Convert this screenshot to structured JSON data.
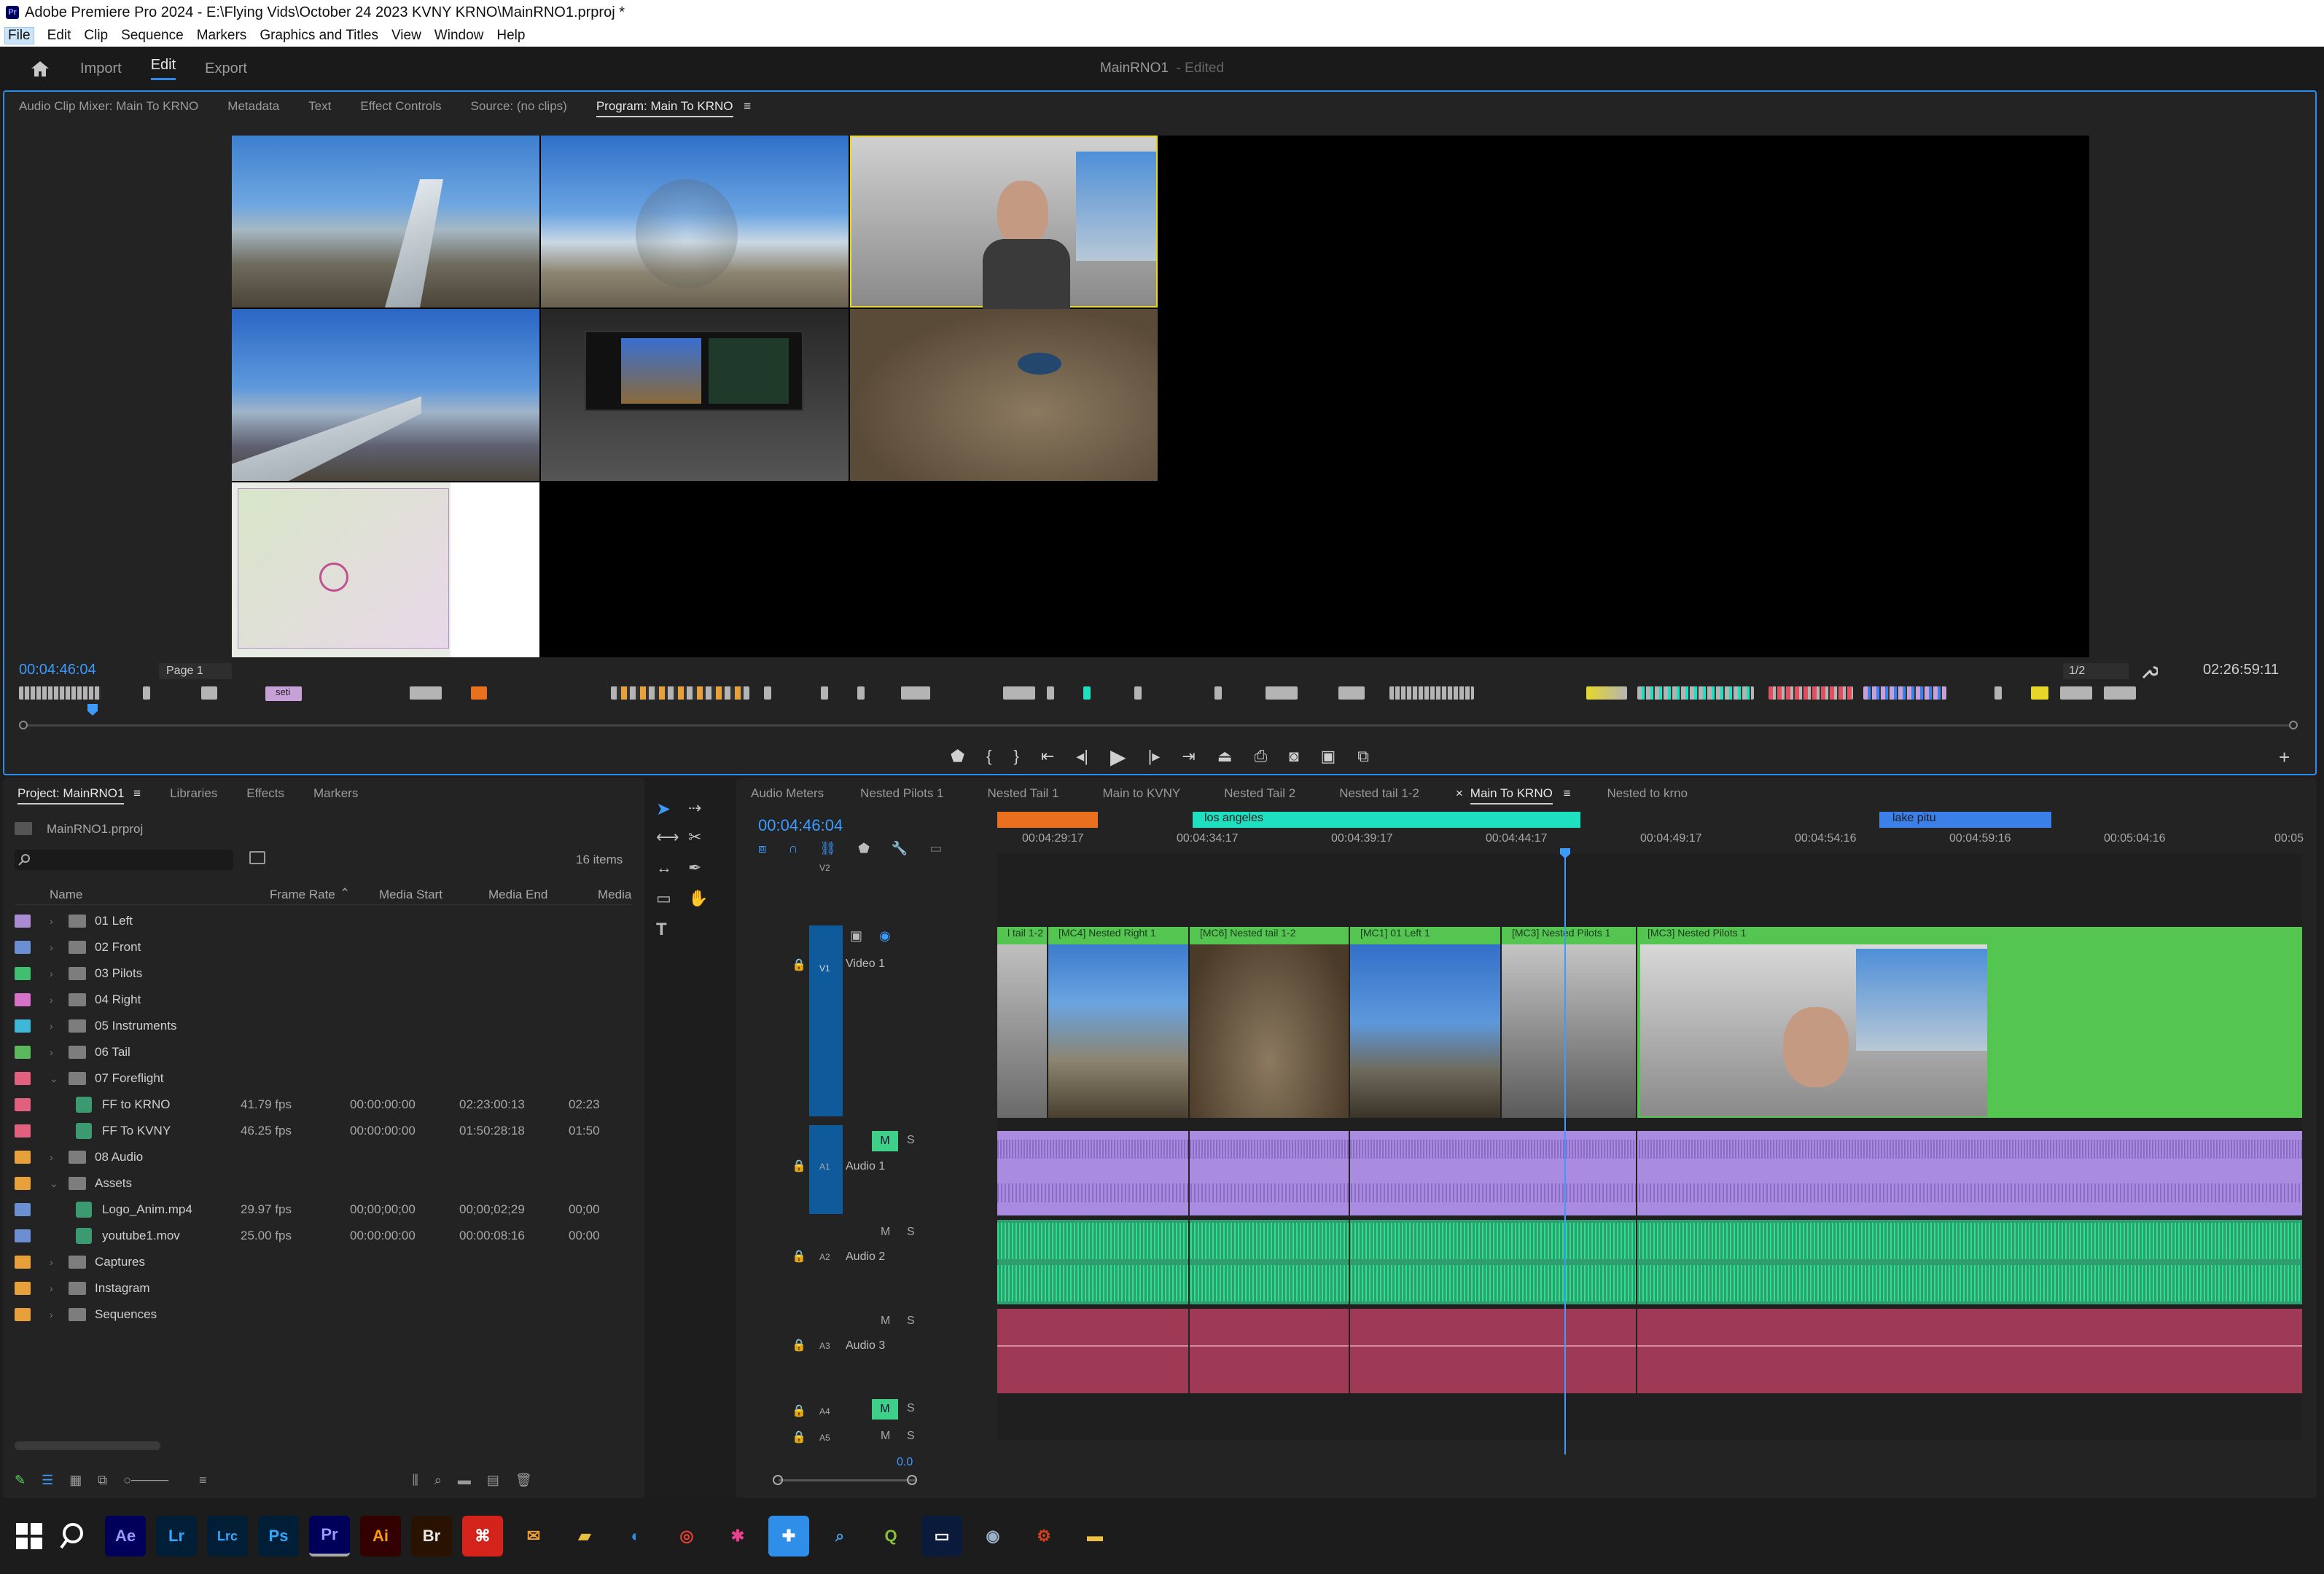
{
  "titlebar": {
    "title": "Adobe Premiere Pro 2024 - E:\\Flying Vids\\October 24 2023 KVNY KRNO\\MainRNO1.prproj *"
  },
  "menu": [
    "File",
    "Edit",
    "Clip",
    "Sequence",
    "Markers",
    "Graphics and Titles",
    "View",
    "Window",
    "Help"
  ],
  "header": {
    "workspaces": [
      "Import",
      "Edit",
      "Export"
    ],
    "active": "Edit",
    "project_name": "MainRNO1",
    "edited": "- Edited"
  },
  "monitor": {
    "tabs": [
      "Audio Clip Mixer: Main To KRNO",
      "Metadata",
      "Text",
      "Effect Controls",
      "Source: (no clips)",
      "Program: Main To KRNO"
    ],
    "active_tab": "Program: Main To KRNO",
    "timecode": "00:04:46:04",
    "page": "Page 1",
    "ratio": "1/2",
    "duration": "02:26:59:11",
    "marker_label": "seti"
  },
  "project": {
    "tabs": [
      "Project: MainRNO1",
      "Libraries",
      "Effects",
      "Markers"
    ],
    "file": "MainRNO1.prproj",
    "items_count": "16 items",
    "columns": [
      "Name",
      "Frame Rate",
      "Media Start",
      "Media End",
      "Media"
    ],
    "rows": [
      {
        "name": "01 Left",
        "type": "folder",
        "color": "#a98cd3"
      },
      {
        "name": "02 Front",
        "type": "folder",
        "color": "#6b8fd1"
      },
      {
        "name": "03 Pilots",
        "type": "folder",
        "color": "#3fbf6f"
      },
      {
        "name": "04 Right",
        "type": "folder",
        "color": "#d672c8"
      },
      {
        "name": "05 Instruments",
        "type": "folder",
        "color": "#3fb7d6"
      },
      {
        "name": "06 Tail",
        "type": "folder",
        "color": "#5cb85c"
      },
      {
        "name": "07 Foreflight",
        "type": "folder",
        "color": "#e0607e",
        "open": true
      },
      {
        "name": "FF to KRNO",
        "type": "seq",
        "color": "#e0607e",
        "fps": "41.79 fps",
        "start": "00:00:00:00",
        "end": "02:23:00:13",
        "media": "02:23"
      },
      {
        "name": "FF To KVNY",
        "type": "seq",
        "color": "#e0607e",
        "fps": "46.25 fps",
        "start": "00:00:00:00",
        "end": "01:50:28:18",
        "media": "01:50"
      },
      {
        "name": "08 Audio",
        "type": "folder",
        "color": "#e8a13a"
      },
      {
        "name": "Assets",
        "type": "folder",
        "color": "#e8a13a",
        "open": true
      },
      {
        "name": "Logo_Anim.mp4",
        "type": "seq",
        "color": "#6b8fd1",
        "fps": "29.97 fps",
        "start": "00;00;00;00",
        "end": "00;00;02;29",
        "media": "00;00"
      },
      {
        "name": "youtube1.mov",
        "type": "seq",
        "color": "#6b8fd1",
        "fps": "25.00 fps",
        "start": "00:00:00:00",
        "end": "00:00:08:16",
        "media": "00:00"
      },
      {
        "name": "Captures",
        "type": "folder",
        "color": "#e8a13a"
      },
      {
        "name": "Instagram",
        "type": "folder",
        "color": "#e8a13a"
      },
      {
        "name": "Sequences",
        "type": "folder",
        "color": "#e8a13a"
      }
    ]
  },
  "timeline": {
    "tabs": [
      "Audio Meters",
      "Nested Pilots 1",
      "Nested Tail 1",
      "Main to KVNY",
      "Nested Tail 2",
      "Nested tail 1-2",
      "Main To KRNO",
      "Nested to krno"
    ],
    "active_tab": "Main To KRNO",
    "timecode": "00:04:46:04",
    "ruler": [
      "00:04:29:17",
      "00:04:34:17",
      "00:04:39:17",
      "00:04:44:17",
      "00:04:49:17",
      "00:04:54:16",
      "00:04:59:16",
      "00:05:04:16",
      "00:05"
    ],
    "markers": [
      {
        "label": "",
        "color": "#e8701e"
      },
      {
        "label": "los angeles",
        "color": "#1ee0c0"
      },
      {
        "label": "lake pitu",
        "color": "#3a80e8"
      }
    ],
    "tracks": {
      "v2": "V2",
      "v1": "V1",
      "v1_name": "Video 1",
      "a1": "A1",
      "a1_name": "Audio 1",
      "a2": "A2",
      "a2_name": "Audio 2",
      "a3": "A3",
      "a3_name": "Audio 3",
      "a4": "A4",
      "a5": "A5"
    },
    "clips": [
      "l tail 1-2",
      "[MC4] Nested Right 1",
      "[MC6] Nested tail 1-2",
      "[MC1] 01 Left 1",
      "[MC3] Nested Pilots 1",
      "[MC3] Nested Pilots 1"
    ],
    "volume": "0.0",
    "btn_m": "M",
    "btn_s": "S"
  },
  "taskbar": [
    "Ae",
    "Lr",
    "Lrc",
    "Ps",
    "Pr",
    "Ai",
    "Br"
  ]
}
